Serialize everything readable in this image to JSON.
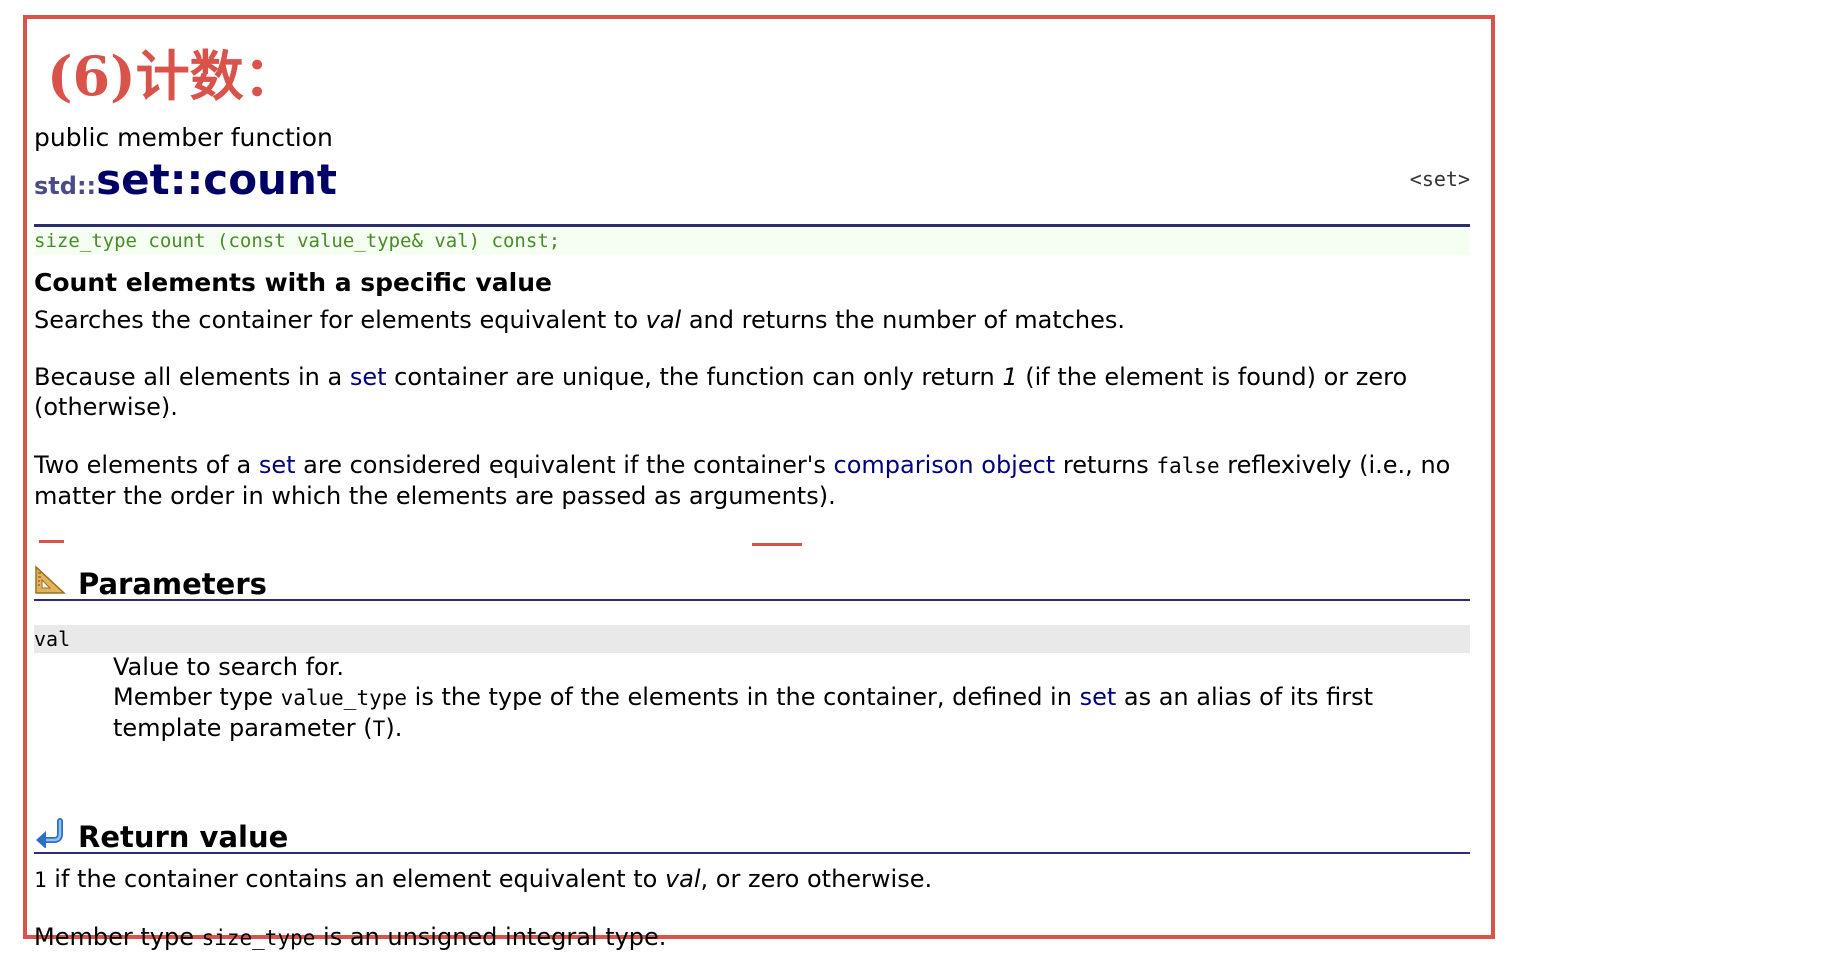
{
  "annotation": {
    "title": "(6)计数：",
    "color": "#d9534a"
  },
  "ref": {
    "kind": "public member function",
    "namespace": "std::",
    "function": "set::count",
    "header": "<set>",
    "prototype": "size_type count (const value_type& val) const;",
    "summary": "Count elements with a specific value",
    "p1": {
      "a": "Searches the container for elements equivalent to ",
      "val": "val",
      "b": " and returns the number of matches."
    },
    "p2": {
      "a": "Because all elements in a ",
      "link": "set",
      "b": " container are unique, the function can only return ",
      "one": "1",
      "c": " (if the element is found) or zero (otherwise)."
    },
    "p3": {
      "a": "Two elements of a ",
      "link1": "set",
      "b": " are considered equivalent if the container's ",
      "link2": "comparison object",
      "c": " returns ",
      "code": "false",
      "d": " reflexively (i.e., no matter the order in which the elements are passed as arguments)."
    }
  },
  "parameters": {
    "title": "Parameters",
    "icon": "ruler-icon",
    "name": "val",
    "desc1": "Value to search for.",
    "desc2": {
      "a": "Member type ",
      "code": "value_type",
      "b": " is the type of the elements in the container, defined in ",
      "link": "set",
      "c": " as an alias of its first template parameter (",
      "t": "T",
      "d": ")."
    }
  },
  "return_value": {
    "title": "Return value",
    "icon": "return-arrow-icon",
    "line1": {
      "code": "1",
      "a": " if the container contains an element equivalent to ",
      "val": "val",
      "b": ", or zero otherwise."
    },
    "line2": {
      "a": "Member type ",
      "code": "size_type",
      "b": " is an unsigned integral type."
    }
  },
  "colors": {
    "link": "#000080",
    "rule": "#2c2c6e",
    "prototype": "#4a8a2a",
    "frame": "#d9534a"
  }
}
